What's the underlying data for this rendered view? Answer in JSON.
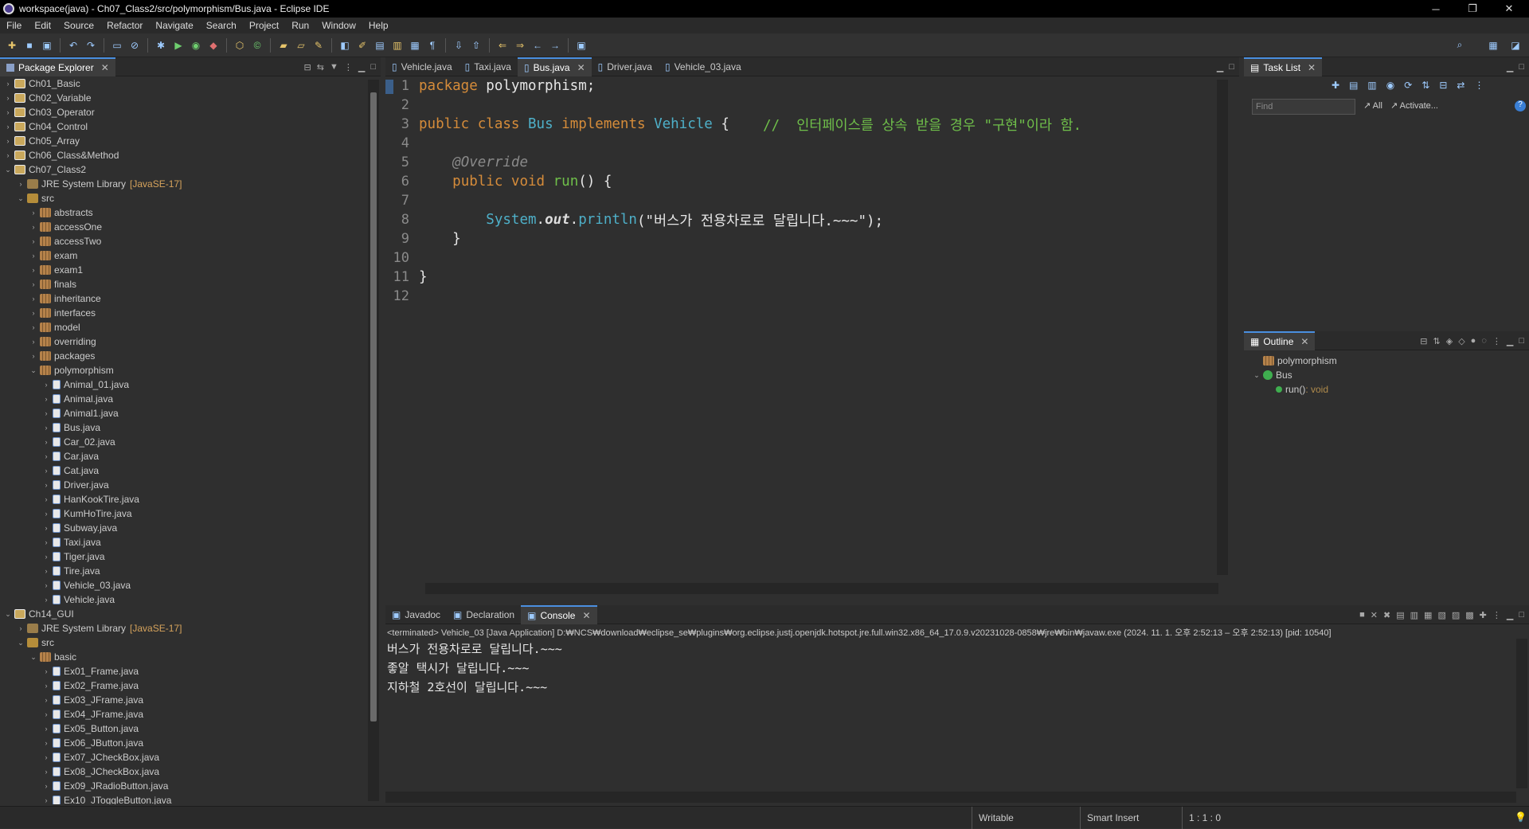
{
  "window": {
    "title": "workspace(java) - Ch07_Class2/src/polymorphism/Bus.java - Eclipse IDE",
    "minimize": "─",
    "restore": "❐",
    "close": "✕"
  },
  "menu": [
    "File",
    "Edit",
    "Source",
    "Refactor",
    "Navigate",
    "Search",
    "Project",
    "Run",
    "Window",
    "Help"
  ],
  "package_explorer": {
    "title": "Package Explorer",
    "tree": [
      {
        "depth": 0,
        "tw": "›",
        "icon": "proj",
        "label": "Ch01_Basic"
      },
      {
        "depth": 0,
        "tw": "›",
        "icon": "proj",
        "label": "Ch02_Variable"
      },
      {
        "depth": 0,
        "tw": "›",
        "icon": "proj",
        "label": "Ch03_Operator"
      },
      {
        "depth": 0,
        "tw": "›",
        "icon": "proj",
        "label": "Ch04_Control"
      },
      {
        "depth": 0,
        "tw": "›",
        "icon": "proj",
        "label": "Ch05_Array"
      },
      {
        "depth": 0,
        "tw": "›",
        "icon": "proj",
        "label": "Ch06_Class&Method"
      },
      {
        "depth": 0,
        "tw": "⌄",
        "icon": "proj",
        "label": "Ch07_Class2"
      },
      {
        "depth": 1,
        "tw": "›",
        "icon": "lib",
        "label": "JRE System Library",
        "extra": "[JavaSE-17]"
      },
      {
        "depth": 1,
        "tw": "⌄",
        "icon": "src",
        "label": "src"
      },
      {
        "depth": 2,
        "tw": "›",
        "icon": "pkg",
        "label": "abstracts"
      },
      {
        "depth": 2,
        "tw": "›",
        "icon": "pkg",
        "label": "accessOne"
      },
      {
        "depth": 2,
        "tw": "›",
        "icon": "pkg",
        "label": "accessTwo"
      },
      {
        "depth": 2,
        "tw": "›",
        "icon": "pkg",
        "label": "exam"
      },
      {
        "depth": 2,
        "tw": "›",
        "icon": "pkg",
        "label": "exam1"
      },
      {
        "depth": 2,
        "tw": "›",
        "icon": "pkg",
        "label": "finals"
      },
      {
        "depth": 2,
        "tw": "›",
        "icon": "pkg",
        "label": "inheritance"
      },
      {
        "depth": 2,
        "tw": "›",
        "icon": "pkg",
        "label": "interfaces"
      },
      {
        "depth": 2,
        "tw": "›",
        "icon": "pkg",
        "label": "model"
      },
      {
        "depth": 2,
        "tw": "›",
        "icon": "pkg",
        "label": "overriding"
      },
      {
        "depth": 2,
        "tw": "›",
        "icon": "pkg",
        "label": "packages"
      },
      {
        "depth": 2,
        "tw": "⌄",
        "icon": "pkg",
        "label": "polymorphism"
      },
      {
        "depth": 3,
        "tw": "›",
        "icon": "java",
        "label": "Animal_01.java"
      },
      {
        "depth": 3,
        "tw": "›",
        "icon": "java",
        "label": "Animal.java"
      },
      {
        "depth": 3,
        "tw": "›",
        "icon": "java",
        "label": "Animal1.java"
      },
      {
        "depth": 3,
        "tw": "›",
        "icon": "java",
        "label": "Bus.java"
      },
      {
        "depth": 3,
        "tw": "›",
        "icon": "java",
        "label": "Car_02.java"
      },
      {
        "depth": 3,
        "tw": "›",
        "icon": "java",
        "label": "Car.java"
      },
      {
        "depth": 3,
        "tw": "›",
        "icon": "java",
        "label": "Cat.java"
      },
      {
        "depth": 3,
        "tw": "›",
        "icon": "java",
        "label": "Driver.java"
      },
      {
        "depth": 3,
        "tw": "›",
        "icon": "java",
        "label": "HanKookTire.java"
      },
      {
        "depth": 3,
        "tw": "›",
        "icon": "java",
        "label": "KumHoTire.java"
      },
      {
        "depth": 3,
        "tw": "›",
        "icon": "java",
        "label": "Subway.java"
      },
      {
        "depth": 3,
        "tw": "›",
        "icon": "java",
        "label": "Taxi.java"
      },
      {
        "depth": 3,
        "tw": "›",
        "icon": "java",
        "label": "Tiger.java"
      },
      {
        "depth": 3,
        "tw": "›",
        "icon": "java",
        "label": "Tire.java"
      },
      {
        "depth": 3,
        "tw": "›",
        "icon": "java",
        "label": "Vehicle_03.java"
      },
      {
        "depth": 3,
        "tw": "›",
        "icon": "java",
        "label": "Vehicle.java"
      },
      {
        "depth": 0,
        "tw": "⌄",
        "icon": "proj",
        "label": "Ch14_GUI"
      },
      {
        "depth": 1,
        "tw": "›",
        "icon": "lib",
        "label": "JRE System Library",
        "extra": "[JavaSE-17]"
      },
      {
        "depth": 1,
        "tw": "⌄",
        "icon": "src",
        "label": "src"
      },
      {
        "depth": 2,
        "tw": "⌄",
        "icon": "pkg",
        "label": "basic"
      },
      {
        "depth": 3,
        "tw": "›",
        "icon": "java",
        "label": "Ex01_Frame.java"
      },
      {
        "depth": 3,
        "tw": "›",
        "icon": "java",
        "label": "Ex02_Frame.java"
      },
      {
        "depth": 3,
        "tw": "›",
        "icon": "java",
        "label": "Ex03_JFrame.java"
      },
      {
        "depth": 3,
        "tw": "›",
        "icon": "java",
        "label": "Ex04_JFrame.java"
      },
      {
        "depth": 3,
        "tw": "›",
        "icon": "java",
        "label": "Ex05_Button.java"
      },
      {
        "depth": 3,
        "tw": "›",
        "icon": "java",
        "label": "Ex06_JButton.java"
      },
      {
        "depth": 3,
        "tw": "›",
        "icon": "java",
        "label": "Ex07_JCheckBox.java"
      },
      {
        "depth": 3,
        "tw": "›",
        "icon": "java",
        "label": "Ex08_JCheckBox.java"
      },
      {
        "depth": 3,
        "tw": "›",
        "icon": "java",
        "label": "Ex09_JRadioButton.java"
      },
      {
        "depth": 3,
        "tw": "›",
        "icon": "java",
        "label": "Ex10_JToggleButton.java"
      }
    ]
  },
  "editor": {
    "tabs": [
      {
        "label": "Vehicle.java",
        "active": false
      },
      {
        "label": "Taxi.java",
        "active": false
      },
      {
        "label": "Bus.java",
        "active": true
      },
      {
        "label": "Driver.java",
        "active": false
      },
      {
        "label": "Vehicle_03.java",
        "active": false
      }
    ],
    "lines": [
      [
        [
          "kw",
          "package"
        ],
        [
          "pl",
          " polymorphism;"
        ]
      ],
      [],
      [
        [
          "kw",
          "public"
        ],
        [
          "pl",
          " "
        ],
        [
          "kw",
          "class"
        ],
        [
          "pl",
          " "
        ],
        [
          "ty",
          "Bus"
        ],
        [
          "pl",
          " "
        ],
        [
          "kw",
          "implements"
        ],
        [
          "pl",
          " "
        ],
        [
          "ty",
          "Vehicle"
        ],
        [
          "pl",
          " {    "
        ],
        [
          "cm",
          "//  인터페이스를 상속 받을 경우 \"구현\"이라 함."
        ]
      ],
      [],
      [
        [
          "pl",
          "    "
        ],
        [
          "an",
          "@Override"
        ]
      ],
      [
        [
          "pl",
          "    "
        ],
        [
          "kw",
          "public"
        ],
        [
          "pl",
          " "
        ],
        [
          "kw",
          "void"
        ],
        [
          "pl",
          " "
        ],
        [
          "fn",
          "run"
        ],
        [
          "pl",
          "() {"
        ]
      ],
      [],
      [
        [
          "pl",
          "        "
        ],
        [
          "ty",
          "System"
        ],
        [
          "pl",
          "."
        ],
        [
          "it",
          "out"
        ],
        [
          "pl",
          "."
        ],
        [
          "ty",
          "println"
        ],
        [
          "st",
          "(\"버스가 전용차로로 달립니다.~~~\");"
        ]
      ],
      [
        [
          "pl",
          "    }"
        ]
      ],
      [],
      [
        [
          "pl",
          "}"
        ]
      ],
      []
    ]
  },
  "task_list": {
    "title": "Task List",
    "find_placeholder": "Find",
    "all": "All",
    "activate": "Activate..."
  },
  "outline": {
    "title": "Outline",
    "items": [
      {
        "label": "polymorphism",
        "type": ""
      },
      {
        "label": "Bus",
        "type": ""
      },
      {
        "label": "run()",
        "type": " : void"
      }
    ]
  },
  "bottom": {
    "tabs": [
      {
        "label": "Javadoc",
        "active": false
      },
      {
        "label": "Declaration",
        "active": false
      },
      {
        "label": "Console",
        "active": true
      }
    ],
    "terminated": "<terminated> Vehicle_03 [Java Application] D:₩NCS₩download₩eclipse_se₩plugins₩org.eclipse.justj.openjdk.hotspot.jre.full.win32.x86_64_17.0.9.v20231028-0858₩jre₩bin₩javaw.exe  (2024. 11. 1. 오후 2:52:13 – 오후 2:52:13) [pid: 10540]",
    "output": [
      "버스가 전용차로로 달립니다.~~~",
      "좋알 택시가 달립니다.~~~",
      "지하철 2호선이 달립니다.~~~"
    ]
  },
  "status": {
    "writable": "Writable",
    "insert": "Smart Insert",
    "position": "1 : 1 : 0"
  },
  "colors": {
    "background": "#2f2f2f",
    "keyword": "#d68c3a",
    "type": "#4eb0c9",
    "method": "#6fbf4a",
    "accent": "#4a8fe0"
  }
}
